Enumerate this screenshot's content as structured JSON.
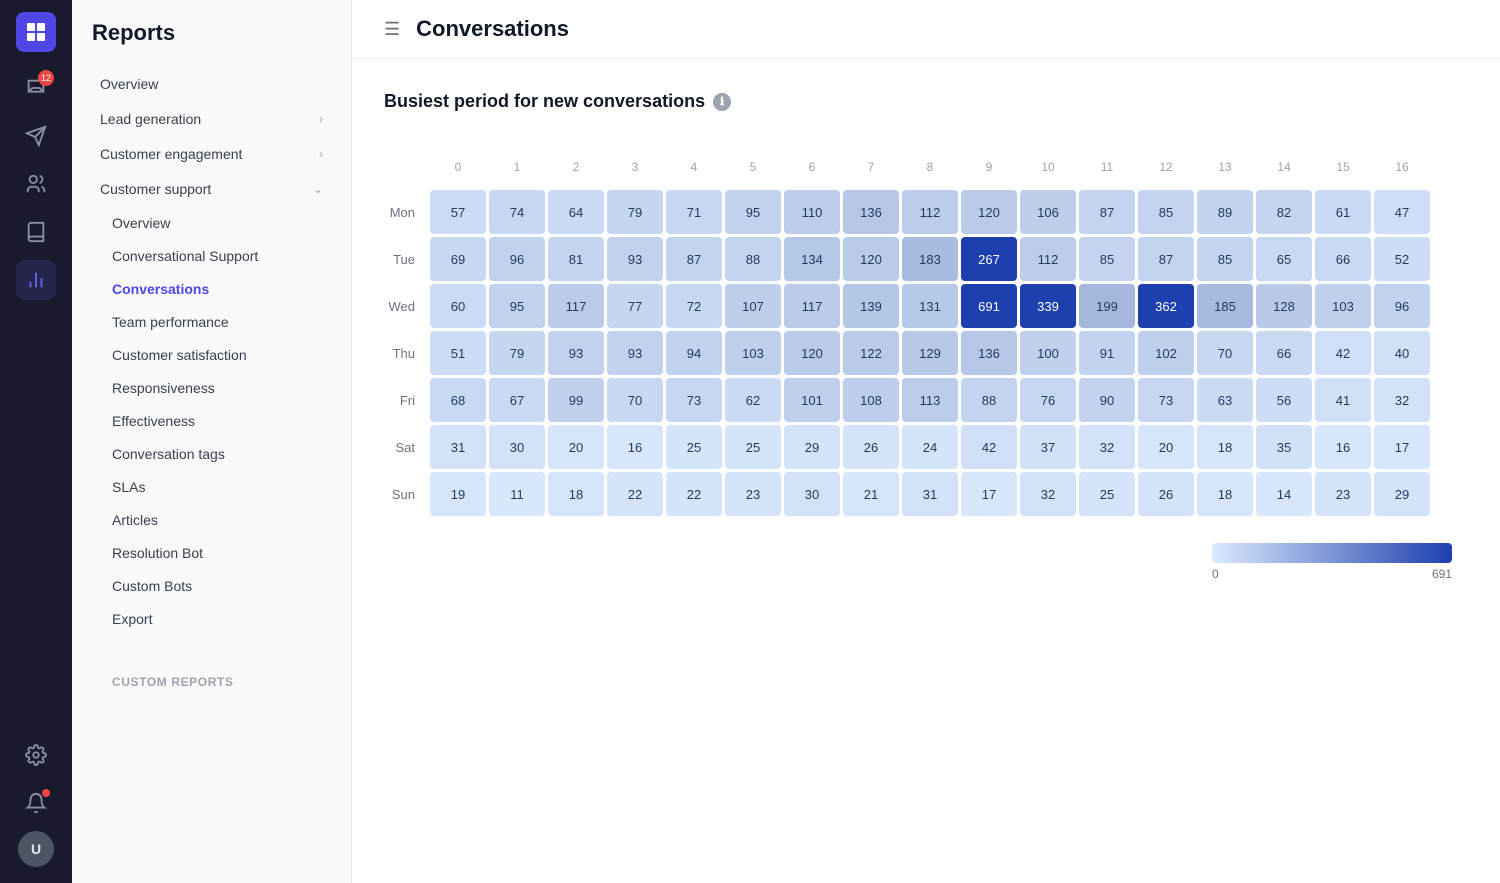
{
  "app": {
    "title": "Reports"
  },
  "iconBar": {
    "badge_count": "12",
    "avatar_initials": "U"
  },
  "sidebar": {
    "title": "Reports",
    "top_items": [
      {
        "id": "overview",
        "label": "Overview"
      },
      {
        "id": "lead-gen",
        "label": "Lead generation",
        "arrow": ">"
      },
      {
        "id": "customer-engagement",
        "label": "Customer engagement",
        "arrow": ">"
      },
      {
        "id": "customer-support",
        "label": "Customer support",
        "arrow": "v"
      }
    ],
    "subitems": [
      {
        "id": "sub-overview",
        "label": "Overview"
      },
      {
        "id": "sub-conv-support",
        "label": "Conversational Support"
      },
      {
        "id": "sub-conversations",
        "label": "Conversations",
        "active": true
      },
      {
        "id": "sub-team-perf",
        "label": "Team performance"
      },
      {
        "id": "sub-csat",
        "label": "Customer satisfaction"
      },
      {
        "id": "sub-responsiveness",
        "label": "Responsiveness"
      },
      {
        "id": "sub-effectiveness",
        "label": "Effectiveness"
      },
      {
        "id": "sub-conv-tags",
        "label": "Conversation tags"
      },
      {
        "id": "sub-slas",
        "label": "SLAs"
      },
      {
        "id": "sub-articles",
        "label": "Articles"
      },
      {
        "id": "sub-resolution-bot",
        "label": "Resolution Bot"
      },
      {
        "id": "sub-custom-bots",
        "label": "Custom Bots"
      },
      {
        "id": "sub-export",
        "label": "Export"
      }
    ],
    "custom_reports_label": "Custom reports"
  },
  "main": {
    "page_title": "Conversations",
    "section_title": "Busiest period for new conversations",
    "legend_min": "0",
    "legend_max": "691"
  },
  "heatmap": {
    "col_labels": [
      "0",
      "1",
      "2",
      "3",
      "4",
      "5",
      "6",
      "7",
      "8",
      "9",
      "10",
      "11",
      "12",
      "13",
      "14",
      "15",
      "16"
    ],
    "rows": [
      {
        "label": "Mon",
        "values": [
          57,
          74,
          64,
          79,
          71,
          95,
          110,
          136,
          112,
          120,
          106,
          87,
          85,
          89,
          82,
          61,
          47
        ]
      },
      {
        "label": "Tue",
        "values": [
          69,
          96,
          81,
          93,
          87,
          88,
          134,
          120,
          183,
          267,
          112,
          85,
          87,
          85,
          65,
          66,
          52
        ]
      },
      {
        "label": "Wed",
        "values": [
          60,
          95,
          117,
          77,
          72,
          107,
          117,
          139,
          131,
          691,
          339,
          199,
          362,
          185,
          128,
          103,
          96
        ]
      },
      {
        "label": "Thu",
        "values": [
          51,
          79,
          93,
          93,
          94,
          103,
          120,
          122,
          129,
          136,
          100,
          91,
          102,
          70,
          66,
          42,
          40
        ]
      },
      {
        "label": "Fri",
        "values": [
          68,
          67,
          99,
          70,
          73,
          62,
          101,
          108,
          113,
          88,
          76,
          90,
          73,
          63,
          56,
          41,
          32
        ]
      },
      {
        "label": "Sat",
        "values": [
          31,
          30,
          20,
          16,
          25,
          25,
          29,
          26,
          24,
          42,
          37,
          32,
          20,
          18,
          35,
          16,
          17
        ]
      },
      {
        "label": "Sun",
        "values": [
          19,
          11,
          18,
          22,
          22,
          23,
          30,
          21,
          31,
          17,
          32,
          25,
          26,
          18,
          14,
          23,
          29
        ]
      }
    ],
    "max_value": 691,
    "highlighted_cells": [
      {
        "row": 1,
        "col": 9,
        "value": 267
      },
      {
        "row": 2,
        "col": 9,
        "value": 691
      },
      {
        "row": 2,
        "col": 10,
        "value": 339
      },
      {
        "row": 2,
        "col": 12,
        "value": 362
      }
    ]
  }
}
